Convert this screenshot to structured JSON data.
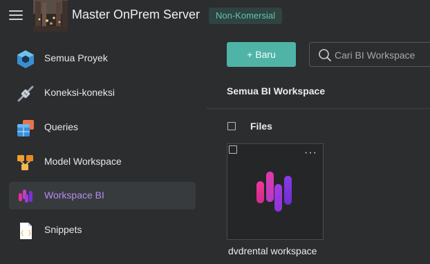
{
  "header": {
    "title": "Master OnPrem Server",
    "badge": "Non-Komersial"
  },
  "sidebar": {
    "items": [
      {
        "label": "Semua Proyek",
        "icon": "hexagon-icon",
        "active": false
      },
      {
        "label": "Koneksi-koneksi",
        "icon": "plug-icon",
        "active": false
      },
      {
        "label": "Queries",
        "icon": "table-icon",
        "active": false
      },
      {
        "label": "Model Workspace",
        "icon": "model-blocks-icon",
        "active": false
      },
      {
        "label": "Workspace BI",
        "icon": "bi-bars-icon",
        "active": true
      },
      {
        "label": "Snippets",
        "icon": "snippet-file-icon",
        "active": false
      }
    ]
  },
  "toolbar": {
    "new_label": "+ Baru",
    "search_placeholder": "Cari BI Workspace"
  },
  "main": {
    "section_title": "Semua BI Workspace",
    "files_label": "Files",
    "cards": [
      {
        "name": "dvdrental workspace",
        "more": "···"
      }
    ]
  },
  "colors": {
    "accent": "#4fb3a5",
    "active_text": "#b48cf0",
    "badge_text": "#5ec4b6"
  }
}
